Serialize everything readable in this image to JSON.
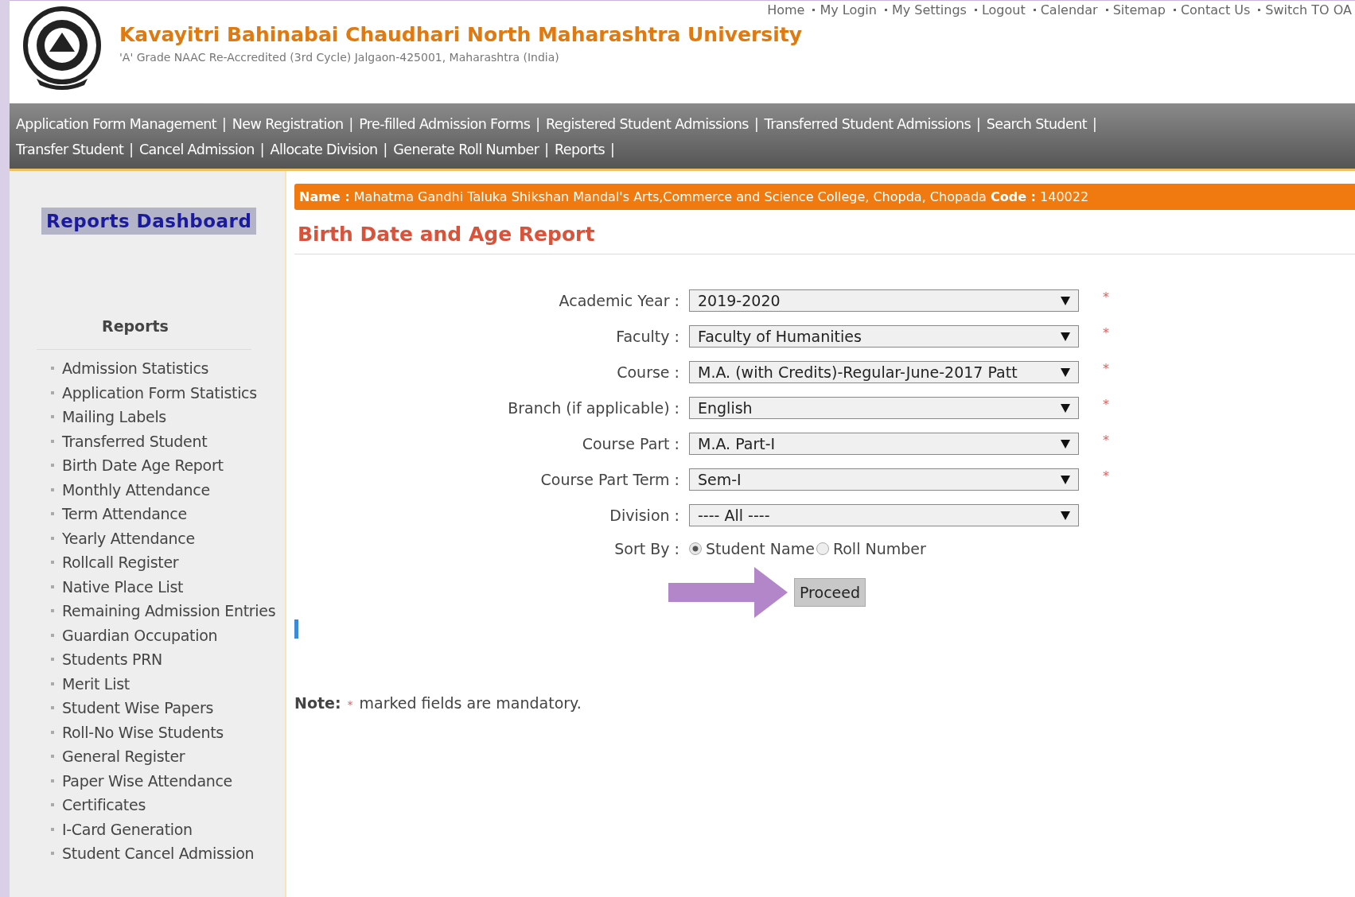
{
  "top_links": [
    "Home",
    "My Login",
    "My Settings",
    "Logout",
    "Calendar",
    "Sitemap",
    "Contact Us",
    "Switch TO OA"
  ],
  "university": {
    "name": "Kavayitri Bahinabai Chaudhari North Maharashtra University",
    "subtitle": "'A' Grade NAAC Re-Accredited (3rd Cycle) Jalgaon-425001, Maharashtra (India)"
  },
  "nav_rows": [
    [
      "Application Form Management",
      "New Registration",
      "Pre-filled Admission Forms",
      "Registered Student Admissions",
      "Transferred Student Admissions",
      "Search Student"
    ],
    [
      "Transfer Student",
      "Cancel Admission",
      "Allocate Division",
      "Generate Roll Number",
      "Reports"
    ]
  ],
  "nav_separator": "|",
  "sidebar": {
    "dashboard_button": "Reports Dashboard",
    "heading": "Reports",
    "items": [
      "Admission Statistics",
      "Application Form Statistics",
      "Mailing Labels",
      "Transferred Student",
      "Birth Date Age Report",
      "Monthly Attendance",
      "Term Attendance",
      "Yearly Attendance",
      "Rollcall Register",
      "Native Place List",
      "Remaining Admission Entries",
      "Guardian Occupation",
      "Students PRN",
      "Merit List",
      "Student Wise Papers",
      "Roll-No Wise Students",
      "General Register",
      "Paper Wise Attendance",
      "Certificates",
      "I-Card Generation",
      "Student Cancel Admission"
    ]
  },
  "college_bar": "**Name :** Mahatma Gandhi Taluka Shikshan Mandal's Arts,Commerce and Science College, Chopda, Chopada **Code :** 140022",
  "page_title": "Birth Date and Age Report",
  "fields": [
    {
      "label": "Academic Year :",
      "value": "2019-2020",
      "mark": "*"
    },
    {
      "label": "Faculty :",
      "value": "Faculty of Humanities",
      "mark": "*"
    },
    {
      "label": "Course :",
      "value": "M.A. (with Credits)-Regular-June-2017 Patt",
      "mark": "*"
    },
    {
      "label": "Branch (if applicable) :",
      "value": "English",
      "mark": "*"
    },
    {
      "label": "Course Part :",
      "value": "M.A. Part-I",
      "mark": "*"
    },
    {
      "label": "Course Part Term :",
      "value": "Sem-I",
      "mark": "*"
    },
    {
      "label": "Division :",
      "value": "---- All ----"
    }
  ],
  "sort": {
    "label": "Sort By :",
    "options": [
      {
        "label": "Student Name",
        "selected": true
      },
      {
        "label": "Roll Number",
        "selected": false
      }
    ]
  },
  "proceed_button": "Proceed",
  "note": {
    "label": "Note:",
    "mark": "*",
    "text": "marked fields are mandatory."
  }
}
